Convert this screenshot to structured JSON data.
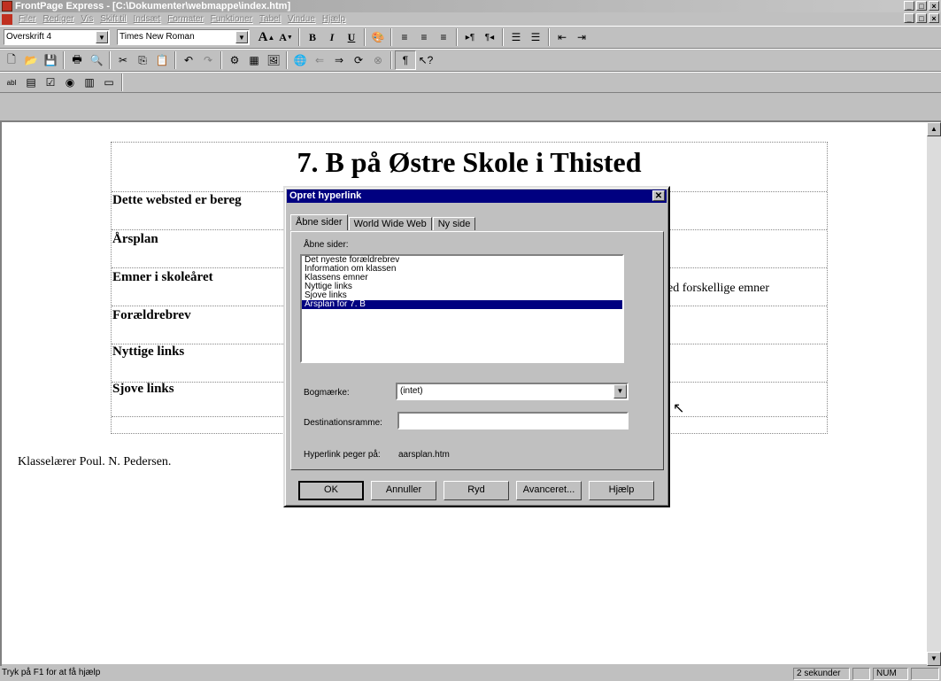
{
  "window": {
    "title": "FrontPage Express - [C:\\Dokumenter\\webmappe\\index.htm]",
    "controls": [
      "_",
      "□",
      "×"
    ]
  },
  "menubar": {
    "items": [
      "Filer",
      "Rediger",
      "Vis",
      "Skift til",
      "Indsæt",
      "Formater",
      "Funktioner",
      "Tabel",
      "Vindue",
      "Hjælp"
    ]
  },
  "toolbar": {
    "style_value": "Overskrift 4",
    "font_value": "Times New Roman"
  },
  "document": {
    "title": "7. B på Østre Skole i Thisted",
    "rows": [
      {
        "label": "Dette websted er bereg",
        "right": ""
      },
      {
        "label": "Årsplan",
        "right": ""
      },
      {
        "label": "Emner i skoleåret",
        "right": "ed forskellige emner"
      },
      {
        "label": "Forældrebrev",
        "right": ""
      },
      {
        "label": "Nyttige links",
        "right": ""
      },
      {
        "label": "Sjove links",
        "right": ""
      }
    ],
    "footer": "Klasselærer Poul. N. Pedersen."
  },
  "dialog": {
    "title": "Opret hyperlink",
    "tabs": [
      "Åbne sider",
      "World Wide Web",
      "Ny side"
    ],
    "list_label": "Åbne sider:",
    "list_items": [
      "Det nyeste forældrebrev",
      "Information om klassen",
      "Klassens emner",
      "Nyttige links",
      "Sjove links",
      "Årsplan for 7. B"
    ],
    "selected_index": 5,
    "bookmark_label": "Bogmærke:",
    "bookmark_value": "(intet)",
    "frame_label": "Destinationsramme:",
    "frame_value": "",
    "link_label": "Hyperlink peger på:",
    "link_value": "aarsplan.htm",
    "buttons": {
      "ok": "OK",
      "cancel": "Annuller",
      "clear": "Ryd",
      "advanced": "Avanceret...",
      "help": "Hjælp"
    }
  },
  "statusbar": {
    "help_text": "Tryk på F1 for at få hjælp",
    "time": "2 sekunder",
    "num": "NUM"
  }
}
